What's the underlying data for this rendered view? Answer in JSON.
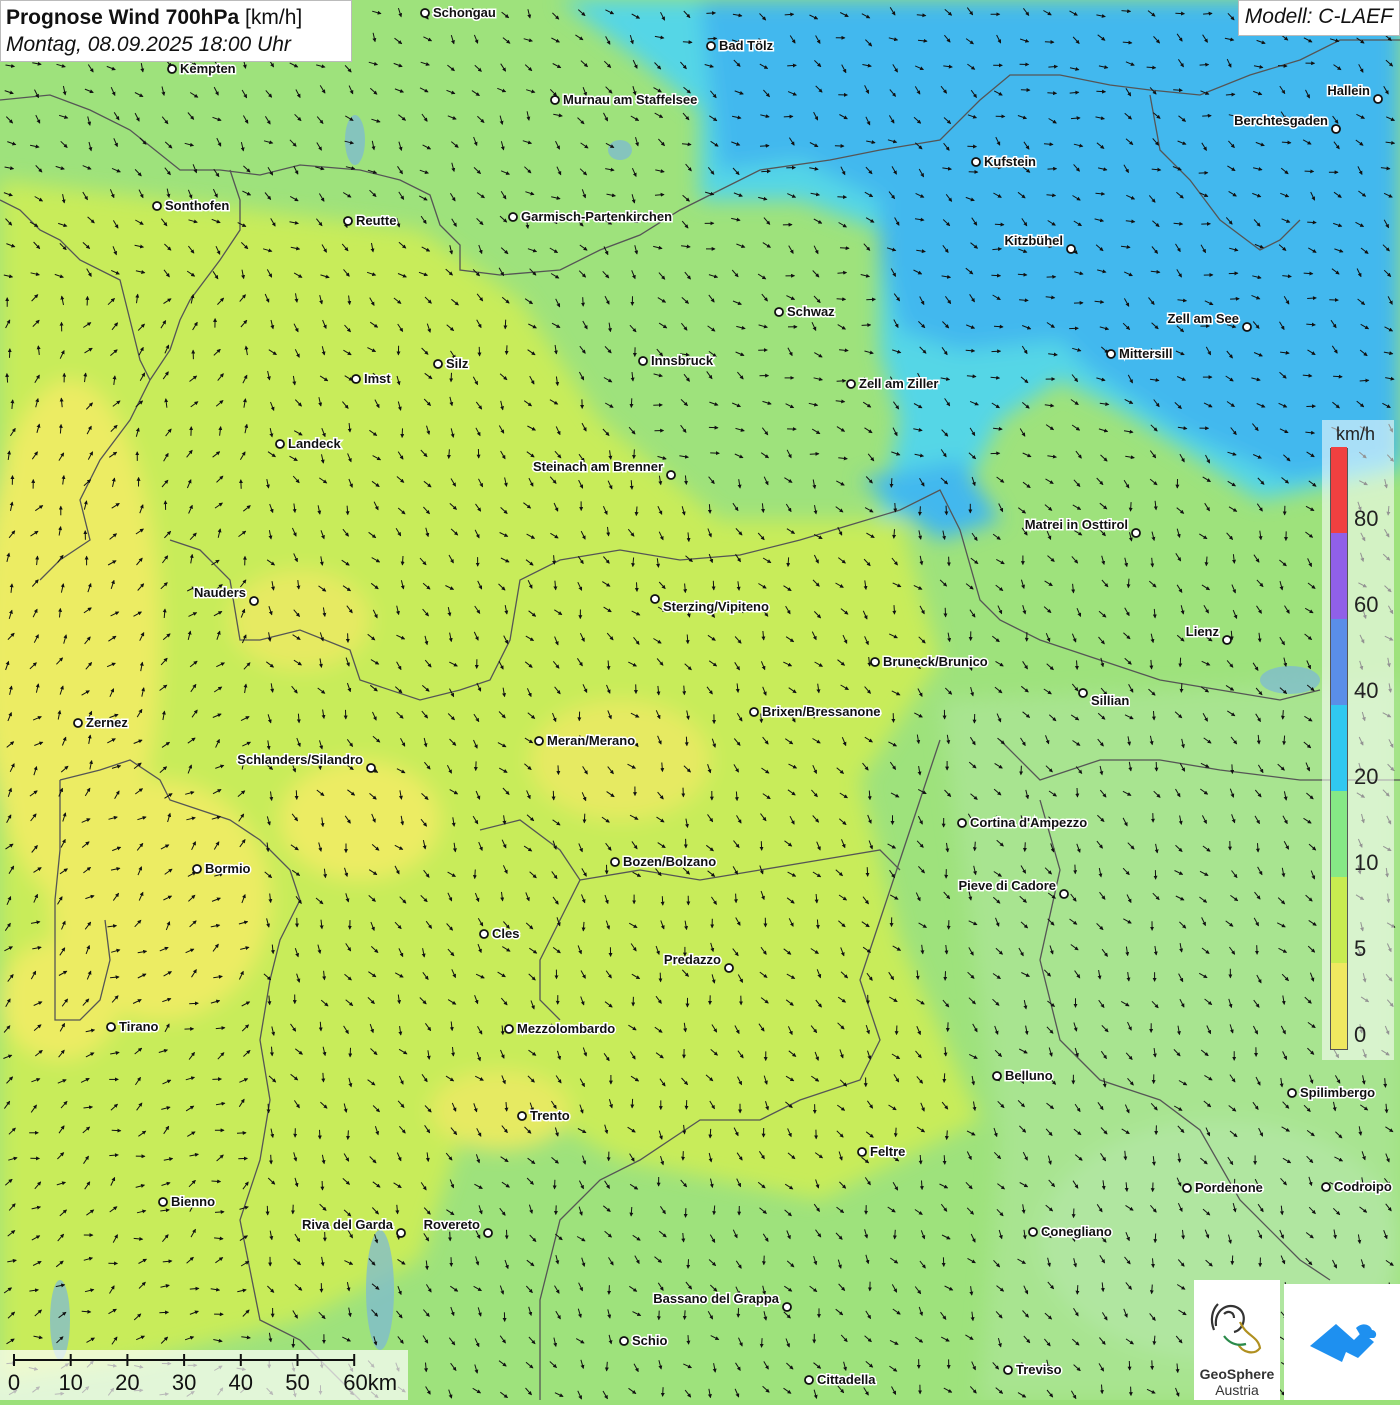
{
  "title": {
    "main": "Prognose Wind 700hPa",
    "unit": "[km/h]",
    "datetime": "Montag, 08.09.2025 18:00 Uhr"
  },
  "model": "Modell: C-LAEF",
  "legend": {
    "unit": "km/h",
    "ticks": [
      "80",
      "60",
      "40",
      "20",
      "10",
      "5",
      "0"
    ],
    "colors": [
      "#f0e860",
      "#c8ec50",
      "#86e886",
      "#30c8f0",
      "#5a8ee8",
      "#9060e8",
      "#f04040"
    ]
  },
  "scale": {
    "labels": [
      "0",
      "10",
      "20",
      "30",
      "40",
      "50",
      "60km"
    ]
  },
  "logos": {
    "geosphere_line1": "GeoSphere",
    "geosphere_line2": "Austria"
  },
  "places": [
    {
      "name": "Schongau"
    },
    {
      "name": "Bad Tölz"
    },
    {
      "name": "Kempten"
    },
    {
      "name": "Hallein"
    },
    {
      "name": "Murnau am Staffelsee"
    },
    {
      "name": "Berchtesgaden"
    },
    {
      "name": "Kufstein"
    },
    {
      "name": "Sonthofen"
    },
    {
      "name": "Reutte"
    },
    {
      "name": "Garmisch-Partenkirchen"
    },
    {
      "name": "Kitzbühel"
    },
    {
      "name": "Schwaz"
    },
    {
      "name": "Zell am See"
    },
    {
      "name": "Mittersill"
    },
    {
      "name": "Innsbruck"
    },
    {
      "name": "Silz"
    },
    {
      "name": "Imst"
    },
    {
      "name": "Zell am Ziller"
    },
    {
      "name": "Landeck"
    },
    {
      "name": "Steinach am Brenner"
    },
    {
      "name": "Matrei in Osttirol"
    },
    {
      "name": "Nauders"
    },
    {
      "name": "Sterzing/Vipiteno"
    },
    {
      "name": "Lienz"
    },
    {
      "name": "Bruneck/Brunico"
    },
    {
      "name": "Sillian"
    },
    {
      "name": "Brixen/Bressanone"
    },
    {
      "name": "Zernez"
    },
    {
      "name": "Meran/Merano"
    },
    {
      "name": "Schlanders/Silandro"
    },
    {
      "name": "Cortina d'Ampezzo"
    },
    {
      "name": "Bormio"
    },
    {
      "name": "Bozen/Bolzano"
    },
    {
      "name": "Pieve di Cadore"
    },
    {
      "name": "Cles"
    },
    {
      "name": "Predazzo"
    },
    {
      "name": "Tirano"
    },
    {
      "name": "Mezzolombardo"
    },
    {
      "name": "Belluno"
    },
    {
      "name": "Spilimbergo"
    },
    {
      "name": "Trento"
    },
    {
      "name": "Feltre"
    },
    {
      "name": "Bienno"
    },
    {
      "name": "Pordenone"
    },
    {
      "name": "Codroipo"
    },
    {
      "name": "Riva del Garda"
    },
    {
      "name": "Rovereto"
    },
    {
      "name": "Conegliano"
    },
    {
      "name": "Bassano del Grappa"
    },
    {
      "name": "Schio"
    },
    {
      "name": "Treviso"
    },
    {
      "name": "Cittadella"
    }
  ]
}
